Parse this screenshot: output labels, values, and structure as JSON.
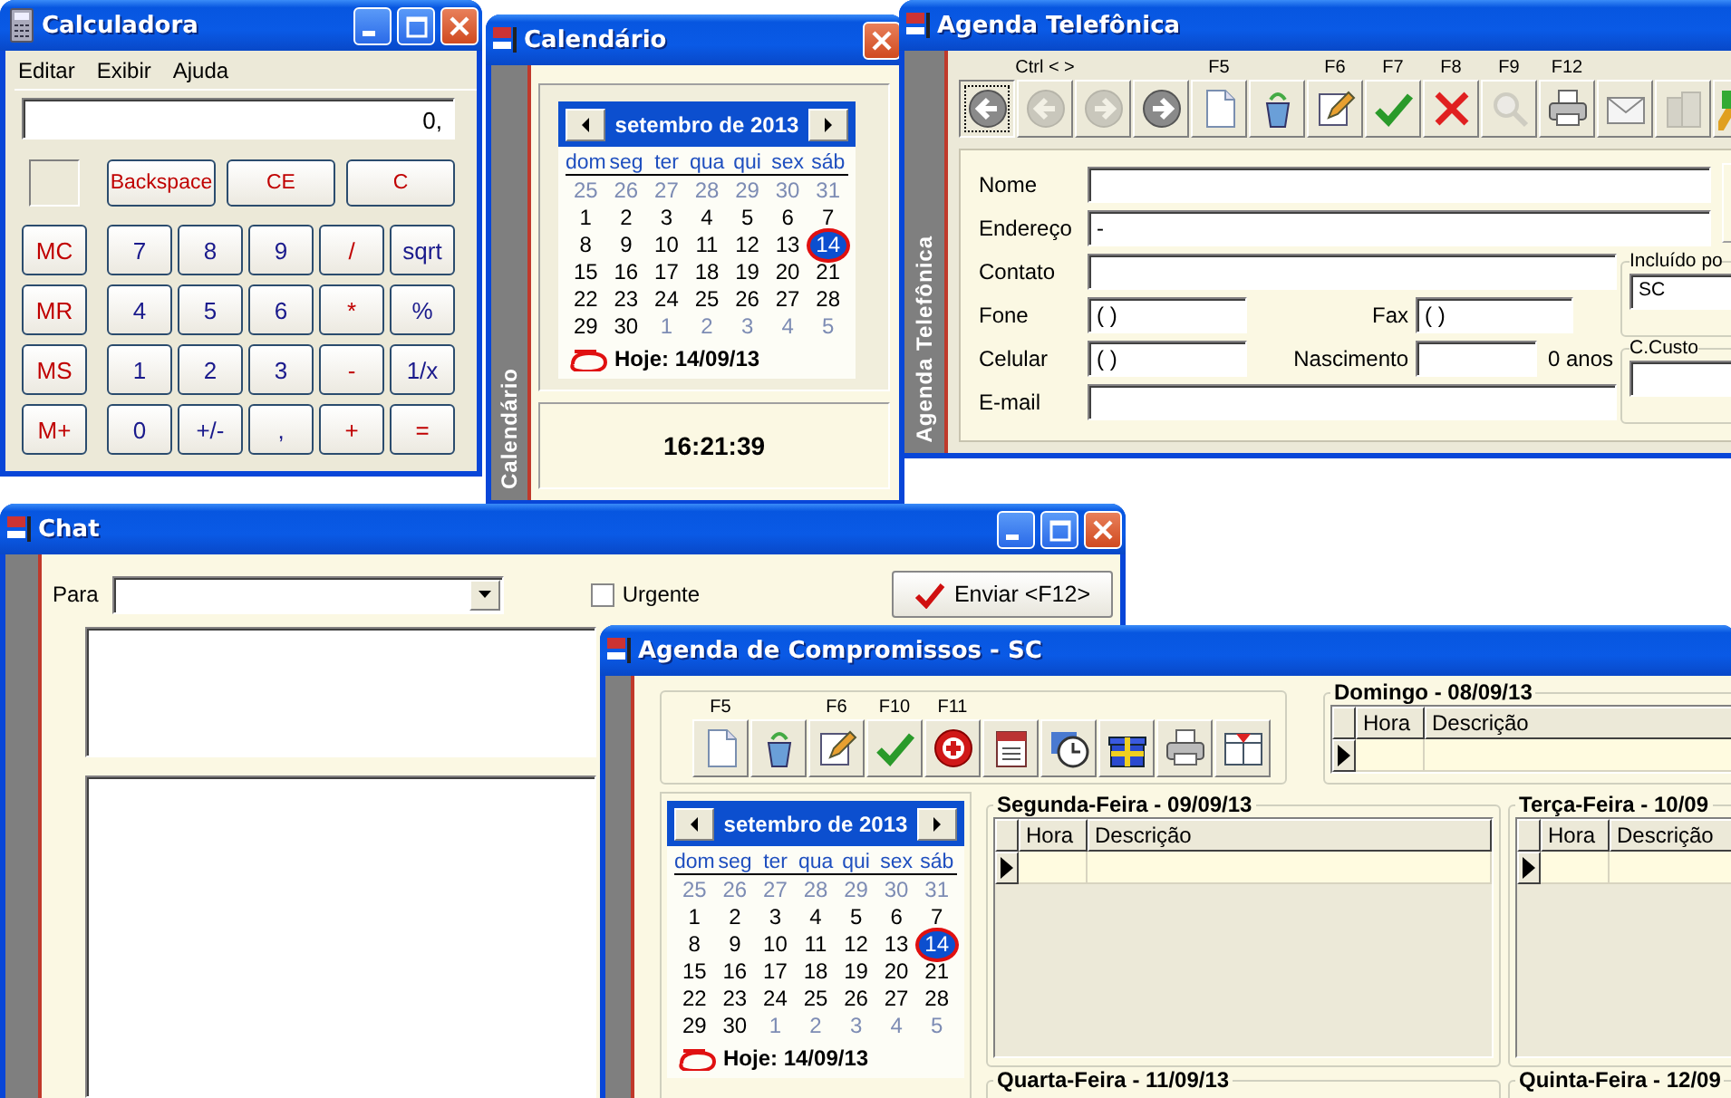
{
  "calculator": {
    "title": "Calculadora",
    "controls": [
      {
        "kind": "minimize"
      },
      {
        "kind": "maximize"
      },
      {
        "kind": "close"
      }
    ],
    "menu": [
      "Editar",
      "Exibir",
      "Ajuda"
    ],
    "display": "0,",
    "top_keys": [
      {
        "label": "Backspace",
        "kind": "clear"
      },
      {
        "label": "CE",
        "kind": "clear"
      },
      {
        "label": "C",
        "kind": "clear"
      }
    ],
    "memory_keys": [
      {
        "label": "MC",
        "kind": "memory"
      },
      {
        "label": "MR",
        "kind": "memory"
      },
      {
        "label": "MS",
        "kind": "memory"
      },
      {
        "label": "M+",
        "kind": "memory"
      }
    ],
    "keys": [
      {
        "label": "7",
        "kind": "digit"
      },
      {
        "label": "8",
        "kind": "digit"
      },
      {
        "label": "9",
        "kind": "digit"
      },
      {
        "label": "/",
        "kind": "operator"
      },
      {
        "label": "sqrt",
        "kind": "function"
      },
      {
        "label": "4",
        "kind": "digit"
      },
      {
        "label": "5",
        "kind": "digit"
      },
      {
        "label": "6",
        "kind": "digit"
      },
      {
        "label": "*",
        "kind": "operator"
      },
      {
        "label": "%",
        "kind": "function"
      },
      {
        "label": "1",
        "kind": "digit"
      },
      {
        "label": "2",
        "kind": "digit"
      },
      {
        "label": "3",
        "kind": "digit"
      },
      {
        "label": "-",
        "kind": "operator"
      },
      {
        "label": "1/x",
        "kind": "function"
      },
      {
        "label": "0",
        "kind": "digit"
      },
      {
        "label": "+/-",
        "kind": "digit"
      },
      {
        "label": ",",
        "kind": "digit"
      },
      {
        "label": "+",
        "kind": "operator"
      },
      {
        "label": "=",
        "kind": "operator"
      }
    ]
  },
  "calendar_window": {
    "title": "Calendário",
    "controls": [
      {
        "kind": "close"
      }
    ],
    "side_label": "Calendário",
    "calendar": {
      "month": "setembro de 2013",
      "weekdays": [
        "dom",
        "seg",
        "ter",
        "qua",
        "qui",
        "sex",
        "sáb"
      ],
      "weeks": [
        [
          {
            "day": "25",
            "in_month": false,
            "selected": false
          },
          {
            "day": "26",
            "in_month": false,
            "selected": false
          },
          {
            "day": "27",
            "in_month": false,
            "selected": false
          },
          {
            "day": "28",
            "in_month": false,
            "selected": false
          },
          {
            "day": "29",
            "in_month": false,
            "selected": false
          },
          {
            "day": "30",
            "in_month": false,
            "selected": false
          },
          {
            "day": "31",
            "in_month": false,
            "selected": false
          }
        ],
        [
          {
            "day": "1",
            "in_month": true,
            "selected": false
          },
          {
            "day": "2",
            "in_month": true,
            "selected": false
          },
          {
            "day": "3",
            "in_month": true,
            "selected": false
          },
          {
            "day": "4",
            "in_month": true,
            "selected": false
          },
          {
            "day": "5",
            "in_month": true,
            "selected": false
          },
          {
            "day": "6",
            "in_month": true,
            "selected": false
          },
          {
            "day": "7",
            "in_month": true,
            "selected": false
          }
        ],
        [
          {
            "day": "8",
            "in_month": true,
            "selected": false
          },
          {
            "day": "9",
            "in_month": true,
            "selected": false
          },
          {
            "day": "10",
            "in_month": true,
            "selected": false
          },
          {
            "day": "11",
            "in_month": true,
            "selected": false
          },
          {
            "day": "12",
            "in_month": true,
            "selected": false
          },
          {
            "day": "13",
            "in_month": true,
            "selected": false
          },
          {
            "day": "14",
            "in_month": true,
            "selected": true
          }
        ],
        [
          {
            "day": "15",
            "in_month": true,
            "selected": false
          },
          {
            "day": "16",
            "in_month": true,
            "selected": false
          },
          {
            "day": "17",
            "in_month": true,
            "selected": false
          },
          {
            "day": "18",
            "in_month": true,
            "selected": false
          },
          {
            "day": "19",
            "in_month": true,
            "selected": false
          },
          {
            "day": "20",
            "in_month": true,
            "selected": false
          },
          {
            "day": "21",
            "in_month": true,
            "selected": false
          }
        ],
        [
          {
            "day": "22",
            "in_month": true,
            "selected": false
          },
          {
            "day": "23",
            "in_month": true,
            "selected": false
          },
          {
            "day": "24",
            "in_month": true,
            "selected": false
          },
          {
            "day": "25",
            "in_month": true,
            "selected": false
          },
          {
            "day": "26",
            "in_month": true,
            "selected": false
          },
          {
            "day": "27",
            "in_month": true,
            "selected": false
          },
          {
            "day": "28",
            "in_month": true,
            "selected": false
          }
        ],
        [
          {
            "day": "29",
            "in_month": true,
            "selected": false
          },
          {
            "day": "30",
            "in_month": true,
            "selected": false
          },
          {
            "day": "1",
            "in_month": false,
            "selected": false
          },
          {
            "day": "2",
            "in_month": false,
            "selected": false
          },
          {
            "day": "3",
            "in_month": false,
            "selected": false
          },
          {
            "day": "4",
            "in_month": false,
            "selected": false
          },
          {
            "day": "5",
            "in_month": false,
            "selected": false
          }
        ]
      ],
      "today": "Hoje: 14/09/13"
    },
    "clock": "16:21:39"
  },
  "phone_book": {
    "title": "Agenda Telefônica",
    "side_label": "Agenda Telefônica",
    "toolbar": [
      {
        "kind": "first",
        "disabled": false,
        "focused": true
      },
      {
        "kind": "prev",
        "key": "Ctrl < >",
        "disabled": true,
        "focused": false
      },
      {
        "kind": "next",
        "disabled": true,
        "focused": false
      },
      {
        "kind": "last",
        "disabled": false,
        "focused": false
      },
      {
        "kind": "new",
        "key": "F5",
        "disabled": false,
        "focused": false
      },
      {
        "kind": "recycle",
        "disabled": false,
        "focused": false
      },
      {
        "kind": "edit",
        "key": "F6",
        "disabled": false,
        "focused": false
      },
      {
        "kind": "confirm",
        "key": "F7",
        "disabled": false,
        "focused": false
      },
      {
        "kind": "cancel",
        "key": "F8",
        "disabled": false,
        "focused": false
      },
      {
        "kind": "search",
        "key": "F9",
        "disabled": true,
        "focused": false
      },
      {
        "kind": "print",
        "key": "F12",
        "disabled": false,
        "focused": false
      },
      {
        "kind": "mail",
        "disabled": false,
        "focused": false
      },
      {
        "kind": "building",
        "disabled": true,
        "focused": false
      },
      {
        "kind": "tool",
        "disabled": false,
        "focused": false
      }
    ],
    "form": {
      "name": {
        "label": "Nome"
      },
      "address": {
        "label": "Endereço",
        "value": "-"
      },
      "contact": {
        "label": "Contato"
      },
      "phone": {
        "label": "Fone",
        "value": "( )"
      },
      "fax": {
        "label": "Fax",
        "value": "( )"
      },
      "mobile": {
        "label": "Celular",
        "value": "( )"
      },
      "birth": {
        "label": "Nascimento"
      },
      "age": "0 anos",
      "email": {
        "label": "E-mail"
      }
    },
    "included_by": {
      "label": "Incluído po",
      "value": "SC"
    },
    "cost_center": {
      "label": "C.Custo"
    }
  },
  "chat": {
    "title": "Chat",
    "controls": [
      {
        "kind": "minimize"
      },
      {
        "kind": "maximize"
      },
      {
        "kind": "close"
      }
    ],
    "to": {
      "label": "Para"
    },
    "urgent": {
      "label": "Urgente",
      "checked": false
    },
    "send_button": "Enviar <F12>"
  },
  "appointments": {
    "title": "Agenda de Compromissos - SC",
    "toolbar": [
      {
        "kind": "new",
        "key": "F5"
      },
      {
        "kind": "recycle"
      },
      {
        "kind": "edit",
        "key": "F6"
      },
      {
        "kind": "confirm",
        "key": "F10"
      },
      {
        "kind": "add",
        "key": "F11"
      },
      {
        "kind": "calendar"
      },
      {
        "kind": "clock"
      },
      {
        "kind": "gift"
      },
      {
        "kind": "print"
      },
      {
        "kind": "scale"
      }
    ],
    "calendar": {
      "month": "setembro de 2013",
      "weekdays": [
        "dom",
        "seg",
        "ter",
        "qua",
        "qui",
        "sex",
        "sáb"
      ],
      "weeks": [
        [
          {
            "day": "25",
            "in_month": false,
            "selected": false
          },
          {
            "day": "26",
            "in_month": false,
            "selected": false
          },
          {
            "day": "27",
            "in_month": false,
            "selected": false
          },
          {
            "day": "28",
            "in_month": false,
            "selected": false
          },
          {
            "day": "29",
            "in_month": false,
            "selected": false
          },
          {
            "day": "30",
            "in_month": false,
            "selected": false
          },
          {
            "day": "31",
            "in_month": false,
            "selected": false
          }
        ],
        [
          {
            "day": "1",
            "in_month": true,
            "selected": false
          },
          {
            "day": "2",
            "in_month": true,
            "selected": false
          },
          {
            "day": "3",
            "in_month": true,
            "selected": false
          },
          {
            "day": "4",
            "in_month": true,
            "selected": false
          },
          {
            "day": "5",
            "in_month": true,
            "selected": false
          },
          {
            "day": "6",
            "in_month": true,
            "selected": false
          },
          {
            "day": "7",
            "in_month": true,
            "selected": false
          }
        ],
        [
          {
            "day": "8",
            "in_month": true,
            "selected": false
          },
          {
            "day": "9",
            "in_month": true,
            "selected": false
          },
          {
            "day": "10",
            "in_month": true,
            "selected": false
          },
          {
            "day": "11",
            "in_month": true,
            "selected": false
          },
          {
            "day": "12",
            "in_month": true,
            "selected": false
          },
          {
            "day": "13",
            "in_month": true,
            "selected": false
          },
          {
            "day": "14",
            "in_month": true,
            "selected": true
          }
        ],
        [
          {
            "day": "15",
            "in_month": true,
            "selected": false
          },
          {
            "day": "16",
            "in_month": true,
            "selected": false
          },
          {
            "day": "17",
            "in_month": true,
            "selected": false
          },
          {
            "day": "18",
            "in_month": true,
            "selected": false
          },
          {
            "day": "19",
            "in_month": true,
            "selected": false
          },
          {
            "day": "20",
            "in_month": true,
            "selected": false
          },
          {
            "day": "21",
            "in_month": true,
            "selected": false
          }
        ],
        [
          {
            "day": "22",
            "in_month": true,
            "selected": false
          },
          {
            "day": "23",
            "in_month": true,
            "selected": false
          },
          {
            "day": "24",
            "in_month": true,
            "selected": false
          },
          {
            "day": "25",
            "in_month": true,
            "selected": false
          },
          {
            "day": "26",
            "in_month": true,
            "selected": false
          },
          {
            "day": "27",
            "in_month": true,
            "selected": false
          },
          {
            "day": "28",
            "in_month": true,
            "selected": false
          }
        ],
        [
          {
            "day": "29",
            "in_month": true,
            "selected": false
          },
          {
            "day": "30",
            "in_month": true,
            "selected": false
          },
          {
            "day": "1",
            "in_month": false,
            "selected": false
          },
          {
            "day": "2",
            "in_month": false,
            "selected": false
          },
          {
            "day": "3",
            "in_month": false,
            "selected": false
          },
          {
            "day": "4",
            "in_month": false,
            "selected": false
          },
          {
            "day": "5",
            "in_month": false,
            "selected": false
          }
        ]
      ],
      "today": "Hoje: 14/09/13"
    },
    "days": [
      {
        "title": "Domingo - 08/09/13",
        "columns": [
          "Hora",
          "Descrição"
        ]
      },
      {
        "title": "Segunda-Feira - 09/09/13",
        "columns": [
          "Hora",
          "Descrição"
        ]
      },
      {
        "title": "Terça-Feira - 10/09",
        "columns": [
          "Hora",
          "Descrição"
        ]
      },
      {
        "title": "Quarta-Feira - 11/09/13"
      },
      {
        "title": "Quinta-Feira - 12/09"
      }
    ]
  }
}
